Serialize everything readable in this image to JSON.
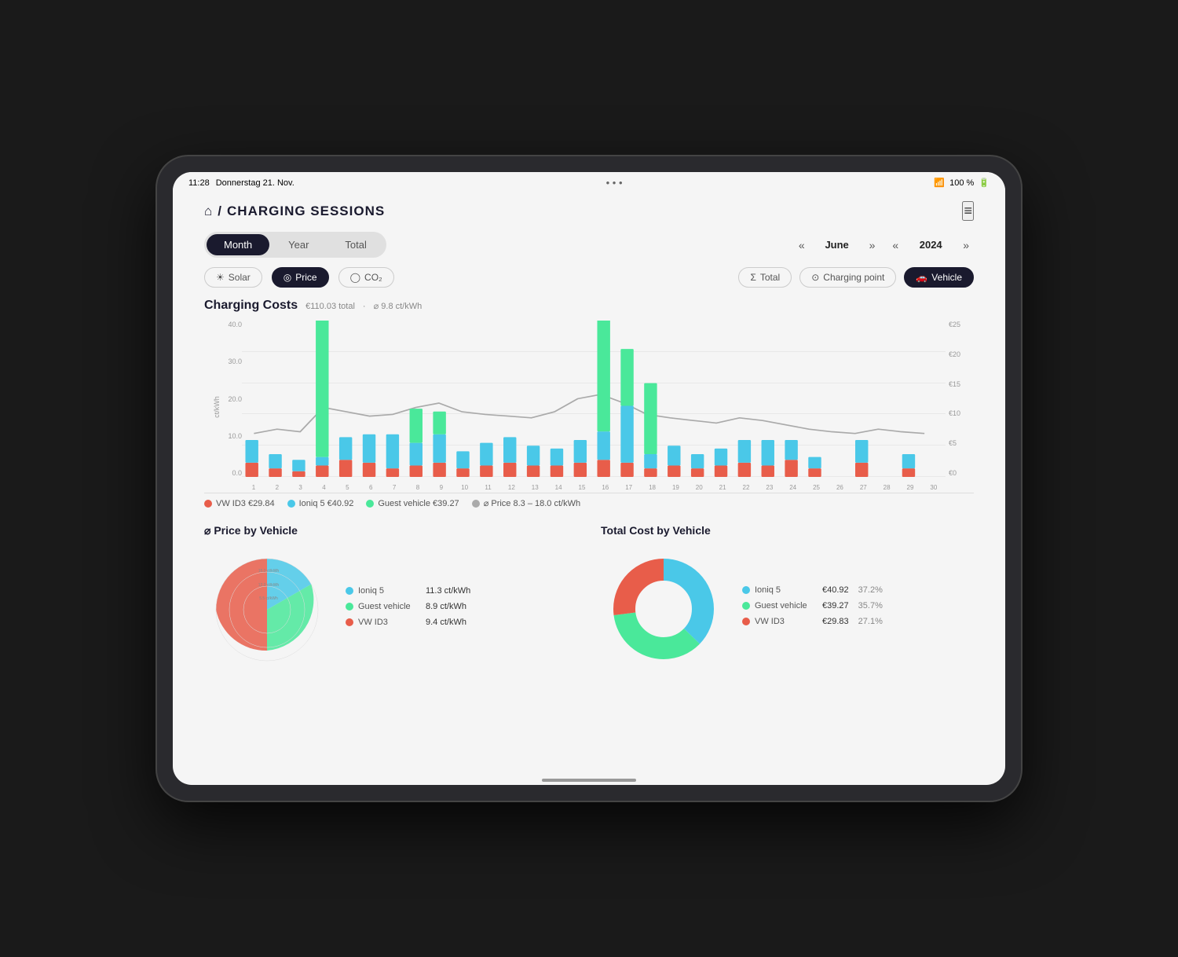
{
  "statusBar": {
    "time": "11:28",
    "date": "Donnerstag 21. Nov.",
    "battery": "100 %",
    "wifi": "WiFi"
  },
  "header": {
    "homeIcon": "⌂",
    "separator": "/",
    "title": "CHARGING SESSIONS",
    "menuIcon": "≡"
  },
  "tabs": {
    "items": [
      "Month",
      "Year",
      "Total"
    ],
    "active": 0
  },
  "navigation": {
    "prevMonthArrow": "«",
    "nextMonthArrow": "»",
    "month": "June",
    "prevYearArrow": "«",
    "nextYearArrow": "»",
    "year": "2024"
  },
  "filters": {
    "left": [
      {
        "label": "Solar",
        "icon": "☀",
        "active": false
      },
      {
        "label": "Price",
        "icon": "◎",
        "active": true
      },
      {
        "label": "CO₂",
        "icon": "◯",
        "active": false
      }
    ],
    "right": [
      {
        "label": "Total",
        "icon": "Σ",
        "active": false
      },
      {
        "label": "Charging point",
        "icon": "⊙",
        "active": false
      },
      {
        "label": "Vehicle",
        "icon": "🚗",
        "active": true
      }
    ]
  },
  "chargingCosts": {
    "title": "Charging Costs",
    "total": "€110.03 total",
    "avg": "⌀ 9.8 ct/kWh",
    "yAxisLeft": [
      "40.0",
      "30.0",
      "20.0",
      "10.0",
      "0.0"
    ],
    "yAxisRight": [
      "€25",
      "€20",
      "€15",
      "€10",
      "€5",
      "€0"
    ],
    "yAxisLabel": "ct/kWh",
    "xLabels": [
      "1",
      "2",
      "3",
      "4",
      "5",
      "6",
      "7",
      "8",
      "9",
      "10",
      "11",
      "12",
      "13",
      "14",
      "15",
      "16",
      "17",
      "18",
      "19",
      "20",
      "21",
      "22",
      "23",
      "24",
      "25",
      "26",
      "27",
      "28",
      "29",
      "30"
    ],
    "legend": [
      {
        "label": "VW ID3",
        "color": "#e85d4a",
        "value": "€29.84"
      },
      {
        "label": "Ioniq 5",
        "color": "#4ac8e8",
        "value": "€40.92"
      },
      {
        "label": "Guest vehicle",
        "color": "#4ae89a",
        "value": "€39.27"
      },
      {
        "label": "⌀ Price",
        "color": "#aaa",
        "value": "8.3 – 18.0 ct/kWh"
      }
    ],
    "bars": [
      {
        "red": 5,
        "cyan": 8,
        "green": 0
      },
      {
        "red": 3,
        "cyan": 5,
        "green": 0
      },
      {
        "red": 2,
        "cyan": 4,
        "green": 0
      },
      {
        "red": 4,
        "cyan": 3,
        "green": 50
      },
      {
        "red": 6,
        "cyan": 8,
        "green": 0
      },
      {
        "red": 5,
        "cyan": 10,
        "green": 0
      },
      {
        "red": 3,
        "cyan": 12,
        "green": 0
      },
      {
        "red": 4,
        "cyan": 8,
        "green": 12
      },
      {
        "red": 5,
        "cyan": 10,
        "green": 8
      },
      {
        "red": 3,
        "cyan": 6,
        "green": 0
      },
      {
        "red": 4,
        "cyan": 8,
        "green": 0
      },
      {
        "red": 5,
        "cyan": 9,
        "green": 0
      },
      {
        "red": 4,
        "cyan": 7,
        "green": 0
      },
      {
        "red": 4,
        "cyan": 6,
        "green": 0
      },
      {
        "red": 5,
        "cyan": 8,
        "green": 0
      },
      {
        "red": 6,
        "cyan": 10,
        "green": 52
      },
      {
        "red": 5,
        "cyan": 20,
        "green": 20
      },
      {
        "red": 3,
        "cyan": 5,
        "green": 25
      },
      {
        "red": 4,
        "cyan": 7,
        "green": 0
      },
      {
        "red": 3,
        "cyan": 5,
        "green": 0
      },
      {
        "red": 4,
        "cyan": 6,
        "green": 0
      },
      {
        "red": 5,
        "cyan": 8,
        "green": 0
      },
      {
        "red": 4,
        "cyan": 9,
        "green": 0
      },
      {
        "red": 6,
        "cyan": 7,
        "green": 0
      },
      {
        "red": 3,
        "cyan": 4,
        "green": 0
      },
      {
        "red": 0,
        "cyan": 0,
        "green": 0
      },
      {
        "red": 5,
        "cyan": 8,
        "green": 0
      },
      {
        "red": 0,
        "cyan": 0,
        "green": 0
      },
      {
        "red": 3,
        "cyan": 5,
        "green": 0
      },
      {
        "red": 0,
        "cyan": 0,
        "green": 0
      }
    ]
  },
  "priceByVehicle": {
    "title": "⌀ Price by Vehicle",
    "items": [
      {
        "label": "Ioniq 5",
        "color": "#4ac8e8",
        "value": "11.3 ct/kWh"
      },
      {
        "label": "Guest vehicle",
        "color": "#4ae89a",
        "value": "8.9 ct/kWh"
      },
      {
        "label": "VW ID3",
        "color": "#e85d4a",
        "value": "9.4 ct/kWh"
      }
    ],
    "ringLabels": [
      "15.0 ct/kWh",
      "12.0 ct/kWh",
      "5.5 ct/kWh"
    ]
  },
  "totalCostByVehicle": {
    "title": "Total Cost by Vehicle",
    "items": [
      {
        "label": "Ioniq 5",
        "color": "#4ac8e8",
        "value": "€40.92",
        "pct": "37.2%",
        "slice": 37.2
      },
      {
        "label": "Guest vehicle",
        "color": "#4ae89a",
        "value": "€39.27",
        "pct": "35.7%",
        "slice": 35.7
      },
      {
        "label": "VW ID3",
        "color": "#e85d4a",
        "value": "€29.83",
        "pct": "27.1%",
        "slice": 27.1
      }
    ]
  }
}
